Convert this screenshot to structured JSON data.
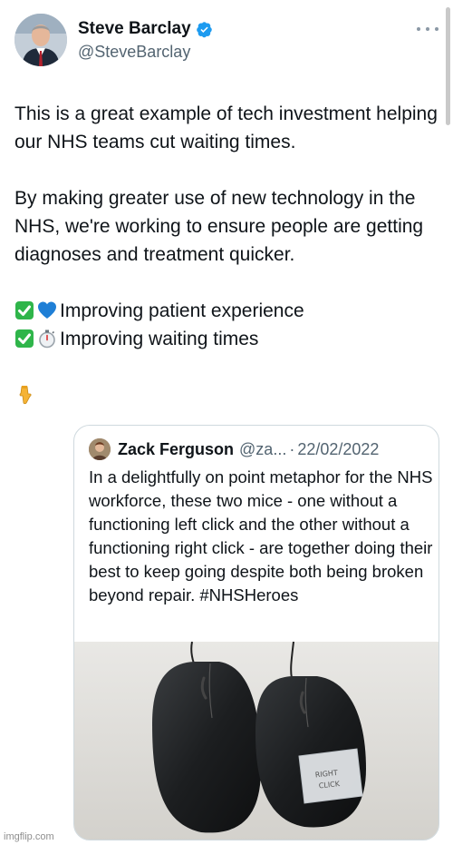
{
  "author": {
    "display_name": "Steve Barclay",
    "handle": "@SteveBarclay",
    "verified": true
  },
  "tweet": {
    "paragraph1": "This is a great example of tech investment helping our NHS teams cut waiting times.",
    "paragraph2": "By making greater use of new technology in the NHS, we're working to ensure people are getting diagnoses and treatment quicker.",
    "line1_text": "Improving patient experience",
    "line2_text": "Improving waiting times",
    "pointing_emoji": "👇"
  },
  "quoted_tweet": {
    "display_name": "Zack Ferguson",
    "handle": "@za...",
    "separator": "·",
    "date": "22/02/2022",
    "text": "In a delightfully on point metaphor for the NHS workforce, these two mice - one without a functioning left click and the other without a functioning right click - are together doing their best to keep going despite both being broken beyond repair. #NHSHeroes",
    "media_label_on_tape": "RIGHT CLICK"
  },
  "watermark": "imgflip.com",
  "colors": {
    "text": "#0f1419",
    "secondary": "#536471",
    "verified_blue": "#1d9bf0",
    "check_green": "#2fb54a",
    "border": "#cfd9de"
  }
}
